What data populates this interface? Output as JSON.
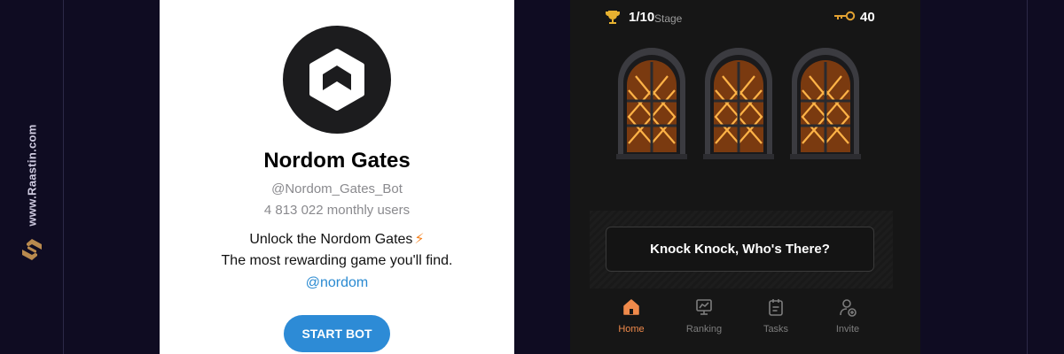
{
  "watermark": {
    "site": "www.Raastin.com"
  },
  "bot_profile": {
    "name": "Nordom Gates",
    "handle": "@Nordom_Gates_Bot",
    "users": "4 813 022 monthly users",
    "description_line1": "Unlock the Nordom Gates",
    "description_icon": "⚡",
    "description_line2": "The most rewarding game you'll find.",
    "channel_link": "@nordom",
    "start_button": "START BOT",
    "avatar_icon": "hexagon-logo-icon"
  },
  "game": {
    "stage_count": "1/10",
    "stage_label": "Stage",
    "keys": "40",
    "gates": [
      "gate-1",
      "gate-2",
      "gate-3"
    ],
    "cta": "Knock Knock, Who's There?",
    "tabs": [
      {
        "label": "Home",
        "icon": "home-icon",
        "active": true
      },
      {
        "label": "Ranking",
        "icon": "ranking-icon",
        "active": false
      },
      {
        "label": "Tasks",
        "icon": "tasks-icon",
        "active": false
      },
      {
        "label": "Invite",
        "icon": "invite-icon",
        "active": false
      }
    ]
  },
  "colors": {
    "background": "#0f0c22",
    "accent_orange": "#f08a4b",
    "telegram_blue": "#2d8bd6",
    "game_bg": "#161616"
  }
}
